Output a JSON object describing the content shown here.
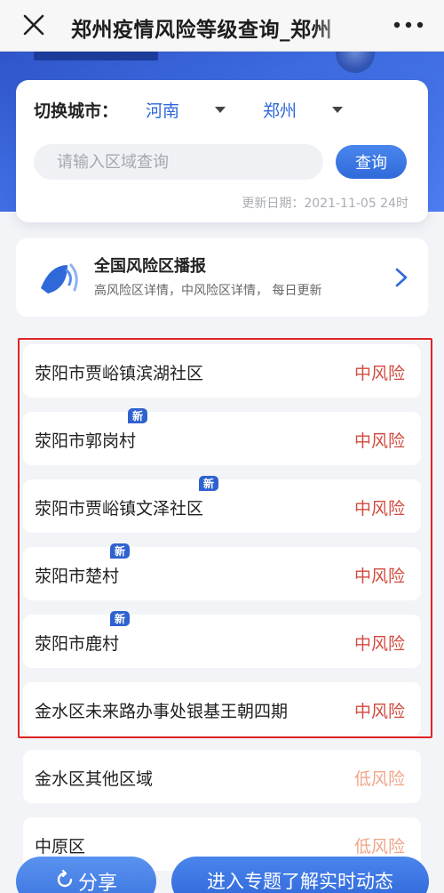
{
  "titlebar": {
    "title": "郑州疫情风险等级查询_郑州",
    "close_icon": "close-icon",
    "more_icon": "more-dots-icon"
  },
  "query_card": {
    "city_label": "切换城市：",
    "province": "河南",
    "city": "郑州",
    "search_placeholder": "请输入区域查询",
    "search_value": "",
    "search_button": "查询",
    "update_date": "更新日期：2021-11-05 24时"
  },
  "broadcast": {
    "title": "全国风险区播报",
    "subtitle": "高风险区详情，中风险区详情，  每日更新",
    "icon": "broadcast-icon"
  },
  "risk_list": [
    {
      "name": "荥阳市贾峪镇滨湖社区",
      "risk": "中风险",
      "level": "mid",
      "is_new": false,
      "badge": ""
    },
    {
      "name": "荥阳市郭岗村",
      "risk": "中风险",
      "level": "mid",
      "is_new": true,
      "badge": "新"
    },
    {
      "name": "荥阳市贾峪镇文泽社区",
      "risk": "中风险",
      "level": "mid",
      "is_new": true,
      "badge": "新"
    },
    {
      "name": "荥阳市楚村",
      "risk": "中风险",
      "level": "mid",
      "is_new": true,
      "badge": "新"
    },
    {
      "name": "荥阳市鹿村",
      "risk": "中风险",
      "level": "mid",
      "is_new": true,
      "badge": "新"
    },
    {
      "name": "金水区未来路办事处银基王朝四期",
      "risk": "中风险",
      "level": "mid",
      "is_new": false,
      "badge": ""
    },
    {
      "name": "金水区其他区域",
      "risk": "低风险",
      "level": "low",
      "is_new": false,
      "badge": ""
    },
    {
      "name": "中原区",
      "risk": "低风险",
      "level": "low",
      "is_new": false,
      "badge": ""
    }
  ],
  "bottom": {
    "share_label": "分享",
    "topic_label": "进入专题了解实时动态"
  },
  "colors": {
    "accent": "#2f68d8",
    "mid_risk": "#d24a3f",
    "low_risk": "#f0a58a",
    "highlight_border": "#e02424"
  }
}
